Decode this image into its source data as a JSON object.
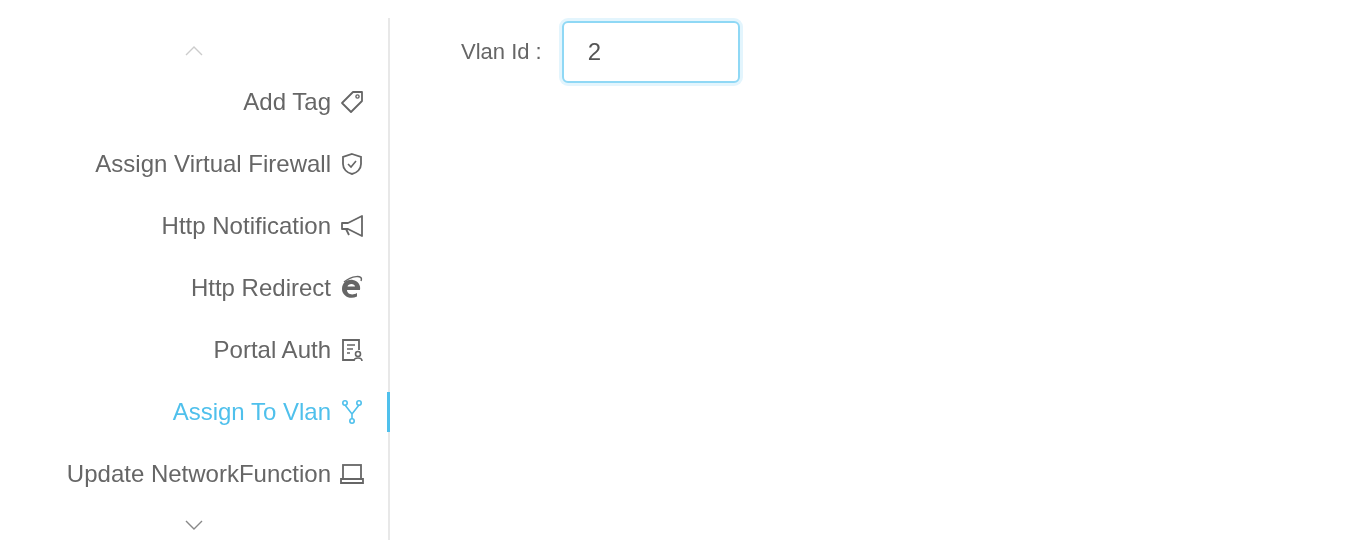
{
  "sidebar": {
    "items": [
      {
        "label": "Add Tag",
        "selected": false
      },
      {
        "label": "Assign Virtual Firewall",
        "selected": false
      },
      {
        "label": "Http Notification",
        "selected": false
      },
      {
        "label": "Http Redirect",
        "selected": false
      },
      {
        "label": "Portal Auth",
        "selected": false
      },
      {
        "label": "Assign To Vlan",
        "selected": true
      },
      {
        "label": "Update NetworkFunction",
        "selected": false
      }
    ]
  },
  "form": {
    "fields": [
      {
        "label": "Vlan Id :",
        "value": "2"
      }
    ]
  }
}
